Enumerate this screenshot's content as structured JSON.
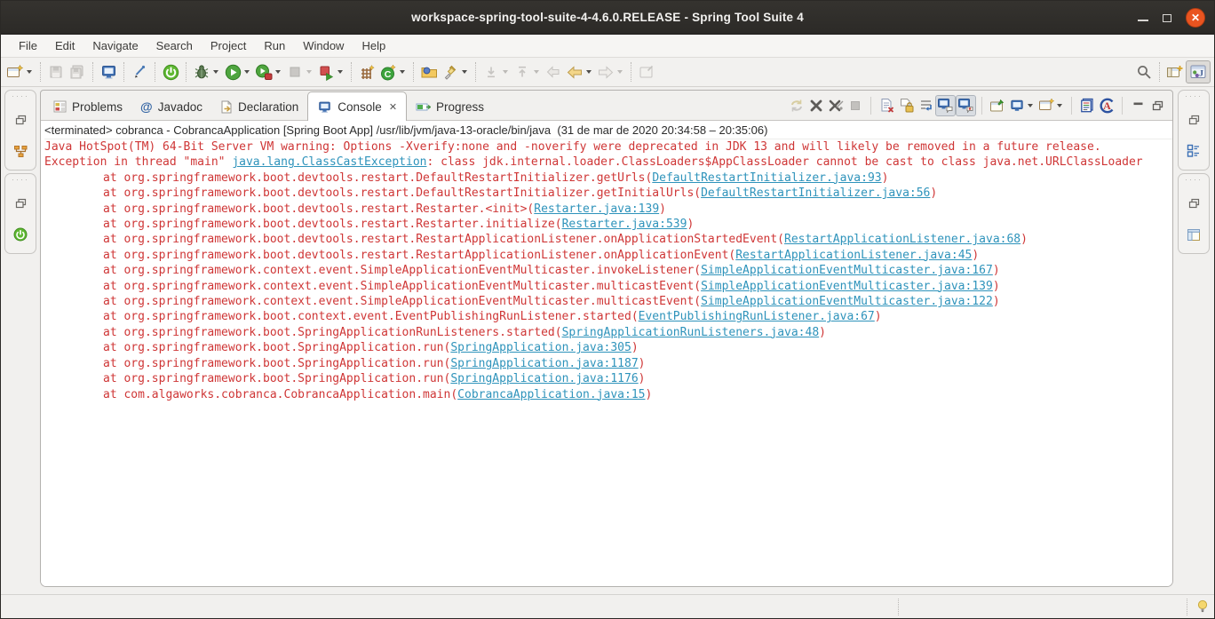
{
  "window": {
    "title": "workspace-spring-tool-suite-4-4.6.0.RELEASE - Spring Tool Suite 4"
  },
  "menubar": {
    "items": [
      "File",
      "Edit",
      "Navigate",
      "Search",
      "Project",
      "Run",
      "Window",
      "Help"
    ]
  },
  "main_toolbar": {
    "icons": [
      "new-wizard",
      "save",
      "save-all",
      "terminal",
      "mark-occurrences",
      "spring-boot",
      "debug",
      "run",
      "profile",
      "stop",
      "run-history",
      "new-java-project",
      "new-java-class",
      "open-type",
      "search-flashlight",
      "next-annotation",
      "previous-annotation",
      "last-edit-location",
      "back",
      "forward",
      "link-with-editor",
      "search-magnifier",
      "open-perspective",
      "java-perspective"
    ]
  },
  "view_tabs": [
    {
      "label": "Problems"
    },
    {
      "label": "Javadoc"
    },
    {
      "label": "Declaration"
    },
    {
      "label": "Console",
      "active": true,
      "close_glyph": "✕"
    },
    {
      "label": "Progress"
    }
  ],
  "console_toolbar": {
    "icons": [
      "relaunch",
      "remove-launch",
      "remove-all-terminated",
      "terminate",
      "clear-console",
      "scroll-lock",
      "word-wrap",
      "show-stdout-toggle",
      "show-stderr-toggle",
      "pin-console",
      "display-selected-console",
      "open-console",
      "console-log",
      "ansi-console",
      "minimize-view",
      "restore-view"
    ]
  },
  "console": {
    "header": "<terminated> cobranca - CobrancaApplication [Spring Boot App] /usr/lib/jvm/java-13-oracle/bin/java  (31 de mar de 2020 20:34:58 – 20:35:06)",
    "warning": "Java HotSpot(TM) 64-Bit Server VM warning: Options -Xverify:none and -noverify were deprecated in JDK 13 and will likely be removed in a future release.",
    "exception": {
      "prefix": "Exception in thread \"main\" ",
      "link": "java.lang.ClassCastException",
      "suffix": ": class jdk.internal.loader.ClassLoaders$AppClassLoader cannot be cast to class java.net.URLClassLoader"
    },
    "stack": [
      {
        "prefix": "at org.springframework.boot.devtools.restart.DefaultRestartInitializer.getUrls(",
        "link": "DefaultRestartInitializer.java:93",
        "suffix": ")"
      },
      {
        "prefix": "at org.springframework.boot.devtools.restart.DefaultRestartInitializer.getInitialUrls(",
        "link": "DefaultRestartInitializer.java:56",
        "suffix": ")"
      },
      {
        "prefix": "at org.springframework.boot.devtools.restart.Restarter.<init>(",
        "link": "Restarter.java:139",
        "suffix": ")"
      },
      {
        "prefix": "at org.springframework.boot.devtools.restart.Restarter.initialize(",
        "link": "Restarter.java:539",
        "suffix": ")"
      },
      {
        "prefix": "at org.springframework.boot.devtools.restart.RestartApplicationListener.onApplicationStartedEvent(",
        "link": "RestartApplicationListener.java:68",
        "suffix": ")"
      },
      {
        "prefix": "at org.springframework.boot.devtools.restart.RestartApplicationListener.onApplicationEvent(",
        "link": "RestartApplicationListener.java:45",
        "suffix": ")"
      },
      {
        "prefix": "at org.springframework.context.event.SimpleApplicationEventMulticaster.invokeListener(",
        "link": "SimpleApplicationEventMulticaster.java:167",
        "suffix": ")"
      },
      {
        "prefix": "at org.springframework.context.event.SimpleApplicationEventMulticaster.multicastEvent(",
        "link": "SimpleApplicationEventMulticaster.java:139",
        "suffix": ")"
      },
      {
        "prefix": "at org.springframework.context.event.SimpleApplicationEventMulticaster.multicastEvent(",
        "link": "SimpleApplicationEventMulticaster.java:122",
        "suffix": ")"
      },
      {
        "prefix": "at org.springframework.boot.context.event.EventPublishingRunListener.started(",
        "link": "EventPublishingRunListener.java:67",
        "suffix": ")"
      },
      {
        "prefix": "at org.springframework.boot.SpringApplicationRunListeners.started(",
        "link": "SpringApplicationRunListeners.java:48",
        "suffix": ")"
      },
      {
        "prefix": "at org.springframework.boot.SpringApplication.run(",
        "link": "SpringApplication.java:305",
        "suffix": ")"
      },
      {
        "prefix": "at org.springframework.boot.SpringApplication.run(",
        "link": "SpringApplication.java:1187",
        "suffix": ")"
      },
      {
        "prefix": "at org.springframework.boot.SpringApplication.run(",
        "link": "SpringApplication.java:1176",
        "suffix": ")"
      },
      {
        "prefix": "at com.algaworks.cobranca.CobrancaApplication.main(",
        "link": "CobrancaApplication.java:15",
        "suffix": ")"
      }
    ]
  },
  "colors": {
    "stderr_red": "#cf3636",
    "hyperlink_blue": "#2e93bb",
    "close_button_orange": "#e95420",
    "spring_green": "#5fb832",
    "titlebar": "#2c2a27"
  }
}
